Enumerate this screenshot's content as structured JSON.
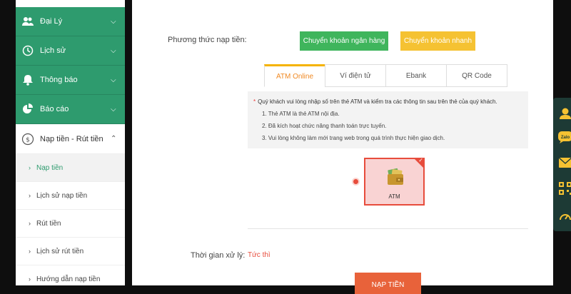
{
  "sidebar": {
    "groups": [
      {
        "label": "Đại Lý",
        "icon": "users-icon"
      },
      {
        "label": "Lịch sử",
        "icon": "history-icon"
      },
      {
        "label": "Thông báo",
        "icon": "bell-icon"
      },
      {
        "label": "Báo cáo",
        "icon": "pie-chart-icon"
      }
    ],
    "open_group": {
      "label": "Nạp tiền - Rút tiền",
      "icon": "dollar-circle-icon"
    },
    "sub_items": [
      {
        "label": "Nạp tiền",
        "active": true
      },
      {
        "label": "Lịch sử nạp tiền"
      },
      {
        "label": "Rút tiền"
      },
      {
        "label": "Lịch sử rút tiền"
      },
      {
        "label": "Hướng dẫn nạp tiền"
      }
    ]
  },
  "main": {
    "payment_method_label": "Phương thức nạp tiền:",
    "btn_bank": "Chuyển khoản ngân hàng",
    "btn_fast": "Chuyển khoản nhanh",
    "tabs": [
      "ATM Online",
      "Ví điện tử",
      "Ebank",
      "QR Code"
    ],
    "active_tab": "ATM Online",
    "note_head": "Quý khách vui lòng nhập số trên thẻ ATM và kiểm tra các thông tin sau trên thẻ của quý khách.",
    "note_lines": [
      "1. Thẻ ATM là thẻ ATM nội địa.",
      "2. Đã kích hoạt chức năng thanh toán trực tuyến.",
      "3. Vui lòng không làm mới trang web trong quá trình thực hiện giao dịch."
    ],
    "atm_label": "ATM",
    "time_label": "Thời gian xử lý:",
    "time_value": "Tức thì",
    "submit_label": "NẠP TIỀN"
  },
  "float_toolbar": [
    {
      "icon": "support-agent-icon"
    },
    {
      "icon": "zalo-icon",
      "text": "Zalo"
    },
    {
      "icon": "mail-icon"
    },
    {
      "icon": "qr-code-icon"
    },
    {
      "icon": "speedometer-icon"
    }
  ],
  "colors": {
    "sidebar_green": "#2e9b6e",
    "btn_bank": "#3fb55c",
    "btn_fast": "#f5c232",
    "accent_red": "#e74c3c",
    "submit": "#e8623a",
    "active_tab_text": "#f08a24"
  }
}
